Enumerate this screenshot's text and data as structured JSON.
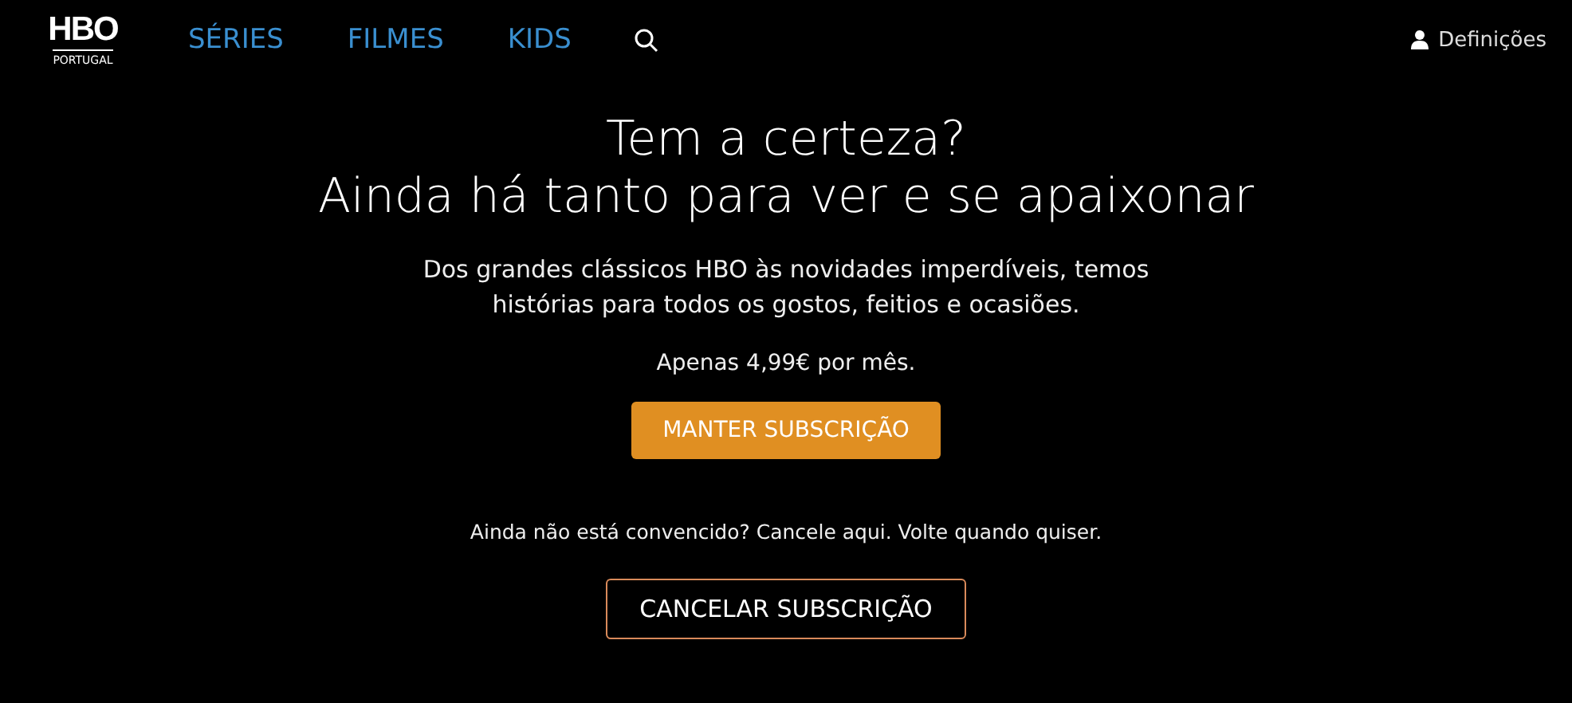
{
  "header": {
    "logo": {
      "brand": "HBO",
      "region": "PORTUGAL"
    },
    "nav": [
      {
        "label": "SÉRIES"
      },
      {
        "label": "FILMES"
      },
      {
        "label": "KIDS"
      }
    ],
    "settings": "Definições"
  },
  "main": {
    "title_lines": [
      "Tem a certeza?",
      "Ainda há tanto para ver e se apaixonar"
    ],
    "description_lines": [
      "Dos grandes clássicos HBO às novidades imperdíveis, temos",
      "histórias para todos os gostos, feitios e ocasiões."
    ],
    "price": "Apenas 4,99€ por mês.",
    "keep_button": "MANTER SUBSCRIÇÃO",
    "cancel_note": "Ainda não está convencido? Cancele aqui. Volte quando quiser.",
    "cancel_button": "CANCELAR SUBSCRIÇÃO"
  }
}
